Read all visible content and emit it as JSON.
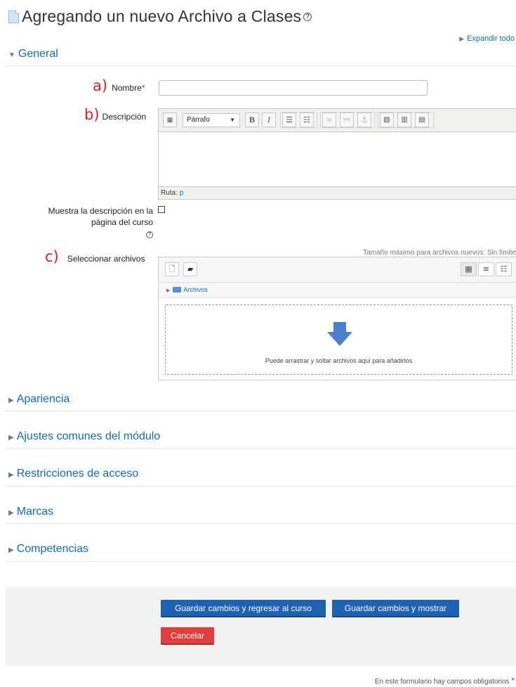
{
  "header": {
    "title": "Agregando un nuevo Archivo a Clases",
    "expand_all": "Expandir todo"
  },
  "sections": {
    "general": "General",
    "appearance": "Apariencia",
    "common_settings": "Ajustes comunes del módulo",
    "restrictions": "Restricciones de acceso",
    "tags": "Marcas",
    "competencies": "Competencias"
  },
  "annotations": {
    "a": "a)",
    "b": "b)",
    "c": "c)"
  },
  "fields": {
    "name_label": "Nombre",
    "name_value": "",
    "description_label": "Descripción",
    "show_description_label": "Muestra la descripción en la página del curso",
    "select_files_label": "Seleccionar archivos"
  },
  "editor": {
    "paragraph_format": "Párrafo",
    "status_prefix": "Ruta:",
    "status_path": "p"
  },
  "filepicker": {
    "max_size": "Tamaño máximo para archivos nuevos: Sin límite",
    "folder": "Archivos",
    "drop_text": "Puede arrastrar y soltar archivos aquí para añadirlos"
  },
  "footer": {
    "save_return": "Guardar cambios y regresar al curso",
    "save_display": "Guardar cambios y mostrar",
    "cancel": "Cancelar",
    "required_note": "En este formulario hay campos obligatorios"
  },
  "colors": {
    "link": "#0f6cbf",
    "primary_button": "#1e62b4",
    "danger_button": "#e33c3c",
    "annotation": "#e02020",
    "drop_arrow": "#4a7fd0"
  },
  "icons": [
    "file-icon",
    "help-icon",
    "chevron-right-icon",
    "chevron-down-icon",
    "folder-icon",
    "add-file-icon",
    "create-folder-icon",
    "icon-view-icon",
    "list-view-icon",
    "tree-view-icon",
    "download-arrow-icon"
  ]
}
